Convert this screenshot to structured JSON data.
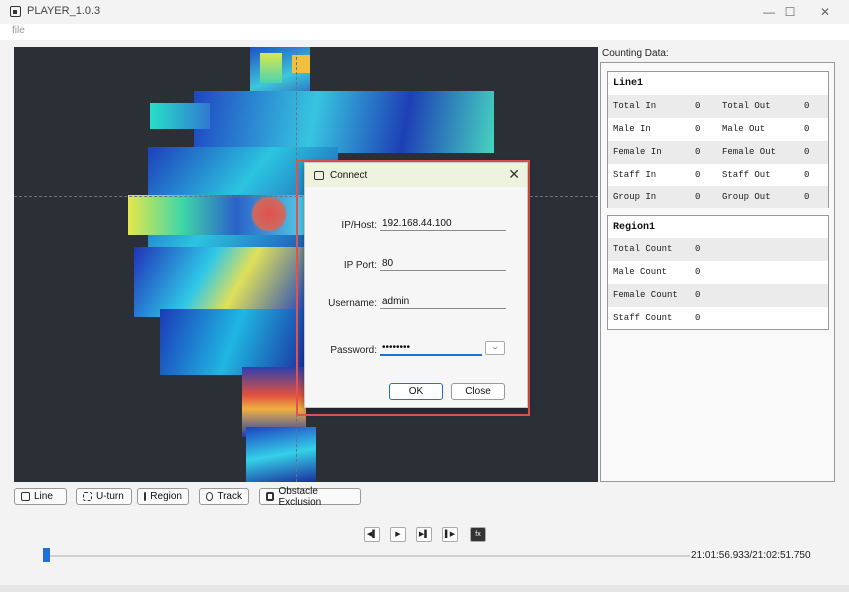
{
  "window": {
    "title": "PLAYER_1.0.3",
    "minimize": "—",
    "maximize": "☐",
    "close": "✕"
  },
  "menu": {
    "file": "file"
  },
  "side": {
    "title": "Counting Data:",
    "line": {
      "name": "Line1",
      "rows": [
        {
          "l1": "Total In",
          "v1": "0",
          "l2": "Total Out",
          "v2": "0"
        },
        {
          "l1": "Male In",
          "v1": "0",
          "l2": "Male Out",
          "v2": "0"
        },
        {
          "l1": "Female In",
          "v1": "0",
          "l2": "Female Out",
          "v2": "0"
        },
        {
          "l1": "Staff In",
          "v1": "0",
          "l2": "Staff Out",
          "v2": "0"
        },
        {
          "l1": "Group In",
          "v1": "0",
          "l2": "Group Out",
          "v2": "0"
        }
      ]
    },
    "region": {
      "name": "Region1",
      "rows": [
        {
          "l1": "Total Count",
          "v1": "0"
        },
        {
          "l1": "Male Count",
          "v1": "0"
        },
        {
          "l1": "Female Count",
          "v1": "0"
        },
        {
          "l1": "Staff Count",
          "v1": "0"
        }
      ]
    }
  },
  "tools": {
    "line": "Line",
    "uturn": "U-turn",
    "region": "Region",
    "track": "Track",
    "obstacle": "Obstacle Exclusion"
  },
  "playback": {
    "prev": "◀▌",
    "play": "▶",
    "next": "▶▌",
    "step": "▌▶",
    "speed": "fx",
    "timecode": "21:01:56.933/21:02:51.750",
    "progress": 0.0
  },
  "dialog": {
    "title": "Connect",
    "close_glyph": "✕",
    "ip_label": "IP/Host:",
    "ip_value": "192.168.44.100",
    "port_label": "IP Port:",
    "port_value": "80",
    "user_label": "Username:",
    "user_value": "admin",
    "pass_label": "Password:",
    "pass_value": "••••••••",
    "eye_glyph": "⌣",
    "ok": "OK",
    "close": "Close"
  },
  "colors": {
    "accent": "#1e6fd9",
    "highlight": "#e2524e",
    "video_bg": "#2b2f36"
  }
}
